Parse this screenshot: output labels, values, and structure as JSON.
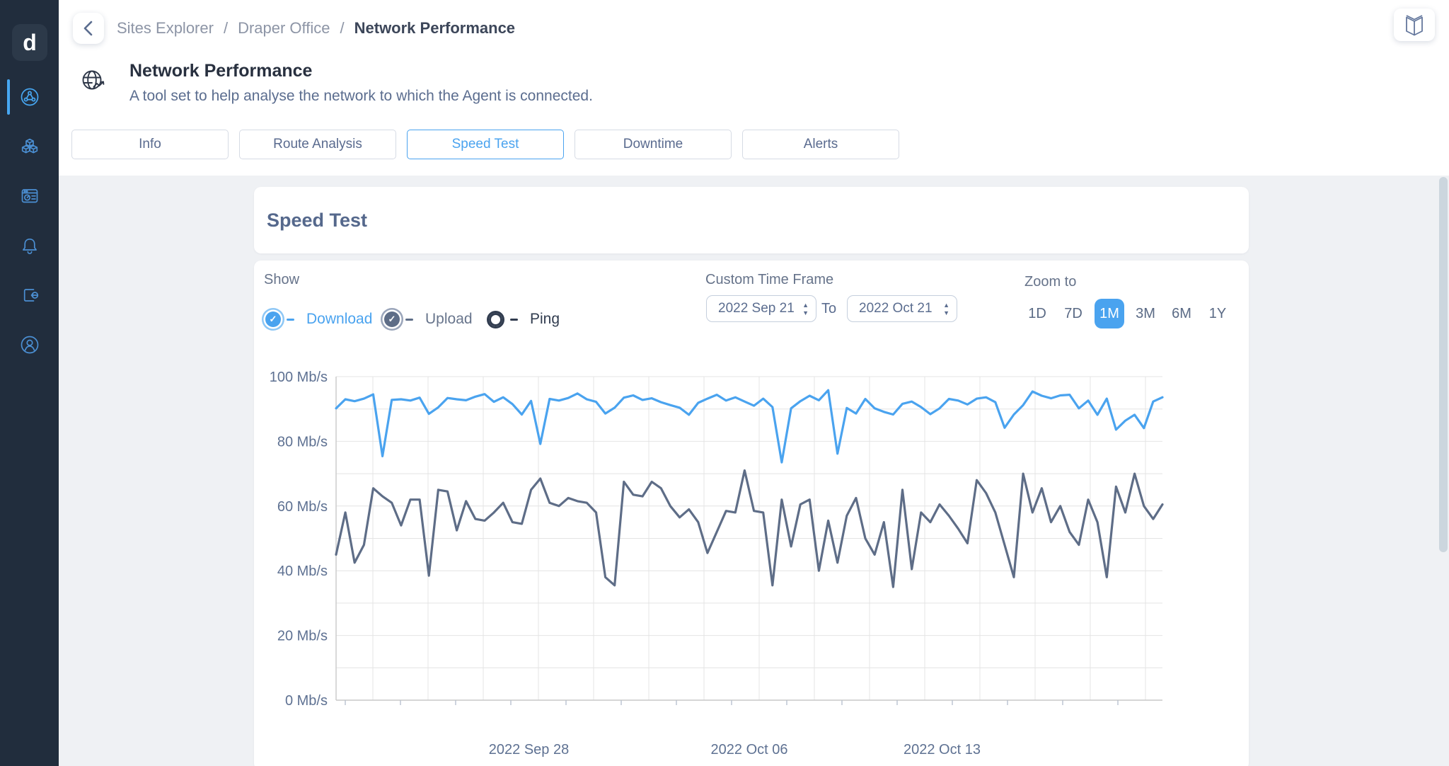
{
  "app": {
    "logo_letter": "d"
  },
  "sidebar": {
    "items": [
      {
        "icon": "network-globe-icon",
        "name": "sites",
        "active": true
      },
      {
        "icon": "cubes-icon",
        "name": "services",
        "active": false
      },
      {
        "icon": "dashboard-icon",
        "name": "dashboard",
        "active": false
      },
      {
        "icon": "bell-icon",
        "name": "alerts",
        "active": false
      },
      {
        "icon": "logout-icon",
        "name": "logout",
        "active": false
      },
      {
        "icon": "user-icon",
        "name": "account",
        "active": false
      }
    ]
  },
  "breadcrumb": {
    "items": [
      "Sites Explorer",
      "Draper Office",
      "Network Performance"
    ],
    "separator": "/"
  },
  "page": {
    "title": "Network Performance",
    "subtitle": "A tool set to help analyse the network to which the Agent is connected."
  },
  "tabs": [
    {
      "label": "Info",
      "active": false
    },
    {
      "label": "Route Analysis",
      "active": false
    },
    {
      "label": "Speed Test",
      "active": true
    },
    {
      "label": "Downtime",
      "active": false
    },
    {
      "label": "Alerts",
      "active": false
    }
  ],
  "card": {
    "title": "Speed Test"
  },
  "controls": {
    "show_label": "Show",
    "series_toggles": [
      {
        "label": "Download",
        "checked": true,
        "color": "#4aa3ef",
        "ring": "#8ec7f5",
        "label_color": "#4aa3ef"
      },
      {
        "label": "Upload",
        "checked": true,
        "color": "#5e6d87",
        "ring": "#9aa5ba",
        "label_color": "#68758c"
      },
      {
        "label": "Ping",
        "checked": false,
        "color": "#313c4f",
        "ring": "#313c4f",
        "label_color": "#313c4f"
      }
    ],
    "timeframe": {
      "label": "Custom Time Frame",
      "from": "2022 Sep 21",
      "to_label": "To",
      "to": "2022 Oct 21"
    },
    "zoom": {
      "label": "Zoom to",
      "options": [
        "1D",
        "7D",
        "1M",
        "3M",
        "6M",
        "1Y"
      ],
      "selected": "1M"
    }
  },
  "chart_data": {
    "type": "line",
    "unit": "Mb/s",
    "ylim": [
      0,
      100
    ],
    "y_tick_step_labeled": 20,
    "y_grid_step": 10,
    "y_tick_labels": [
      "100 Mb/s",
      "80 Mb/s",
      "60 Mb/s",
      "40 Mb/s",
      "20 Mb/s",
      "0 Mb/s"
    ],
    "x_range": [
      "2022 Sep 21",
      "2022 Oct 21"
    ],
    "x_tick_labels": [
      {
        "label": "2022 Sep 28",
        "pos": 0.2333
      },
      {
        "label": "2022 Oct 06",
        "pos": 0.5
      },
      {
        "label": "2022 Oct 13",
        "pos": 0.7333
      }
    ],
    "grid": true,
    "series": [
      {
        "name": "Download",
        "color": "#4aa3ef",
        "values": [
          90.2,
          93.0,
          92.4,
          93.2,
          94.5,
          75.4,
          92.8,
          93.0,
          92.6,
          93.5,
          88.5,
          90.5,
          93.4,
          93.0,
          92.7,
          93.8,
          94.6,
          92.2,
          93.6,
          91.5,
          88.3,
          92.5,
          79.2,
          93.1,
          92.6,
          93.4,
          94.8,
          93.0,
          92.2,
          88.6,
          90.4,
          93.5,
          94.2,
          92.8,
          93.3,
          92.1,
          91.2,
          90.4,
          88.2,
          91.9,
          93.2,
          94.4,
          92.6,
          93.6,
          92.3,
          91.0,
          93.2,
          90.6,
          73.5,
          90.2,
          92.4,
          94.1,
          92.7,
          95.8,
          76.2,
          90.3,
          88.6,
          93.1,
          90.2,
          89.1,
          88.3,
          91.6,
          92.3,
          90.6,
          88.4,
          90.2,
          93.1,
          92.6,
          91.4,
          93.2,
          93.6,
          92.1,
          84.2,
          88.3,
          91.2,
          95.4,
          94.1,
          93.3,
          94.2,
          94.4,
          90.2,
          92.6,
          88.2,
          93.2,
          83.6,
          86.4,
          88.2,
          84.1,
          92.3,
          93.6
        ]
      },
      {
        "name": "Upload",
        "color": "#5e6d87",
        "values": [
          45.0,
          58.0,
          42.5,
          48.0,
          65.5,
          63.0,
          61.0,
          54.0,
          62.0,
          62.0,
          38.5,
          65.0,
          64.5,
          52.5,
          61.5,
          56.0,
          55.5,
          58.0,
          61.0,
          55.0,
          54.5,
          65.0,
          68.5,
          61.0,
          60.0,
          62.5,
          61.5,
          61.0,
          58.0,
          38.0,
          35.5,
          67.5,
          63.5,
          63.0,
          67.5,
          65.5,
          60.0,
          56.5,
          59.0,
          55.0,
          45.5,
          52.0,
          58.5,
          58.0,
          71.0,
          58.5,
          58.0,
          35.5,
          62.0,
          47.5,
          60.5,
          62.0,
          40.0,
          55.5,
          42.5,
          57.0,
          62.5,
          50.0,
          45.0,
          55.0,
          35.0,
          65.0,
          40.5,
          58.0,
          55.0,
          60.5,
          57.0,
          53.0,
          48.5,
          68.0,
          64.0,
          58.0,
          48.0,
          38.0,
          70.0,
          58.0,
          65.5,
          55.0,
          60.0,
          52.0,
          48.0,
          62.0,
          55.0,
          38.0,
          66.0,
          58.0,
          70.0,
          60.0,
          56.0,
          60.5
        ]
      },
      {
        "name": "Ping",
        "color": "#313c4f",
        "values": []
      }
    ]
  },
  "colors": {
    "accent": "#4aa3ef",
    "upload": "#5e6d87",
    "sidebar_bg": "#212d3d",
    "content_bg": "#eff1f4",
    "grid": "#e4e4e4",
    "axis": "#c9c9c9",
    "tick_text": "#5e7192"
  }
}
